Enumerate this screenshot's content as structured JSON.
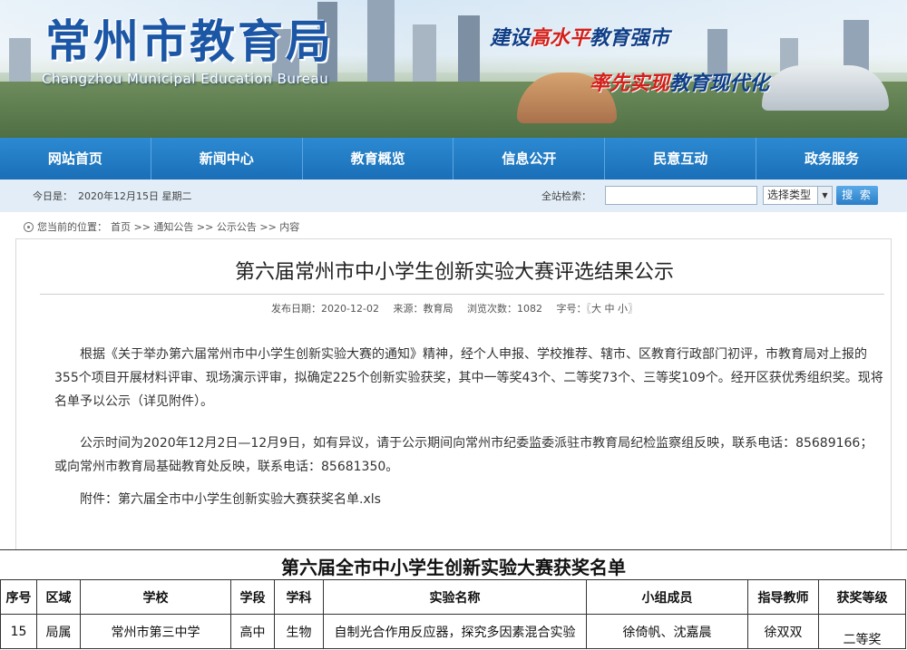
{
  "banner": {
    "title": "常州市教育局",
    "subtitle_en": "Changzhou Municipal Education Bureau",
    "slogan1_pre": "建设",
    "slogan1_hl": "高水平",
    "slogan1_post": "教育强市",
    "slogan2_hl": "率先实现",
    "slogan2_post": "教育现代化"
  },
  "nav": {
    "items": [
      "网站首页",
      "新闻中心",
      "教育概览",
      "信息公开",
      "民意互动",
      "政务服务"
    ]
  },
  "infobar": {
    "today_label": "今日是：",
    "today_value": "2020年12月15日 星期二",
    "search_label": "全站检索：",
    "search_value": "",
    "type_select": "选择类型",
    "search_button": "搜 索"
  },
  "breadcrumb": {
    "prefix": "您当前的位置：",
    "path": "首页 >> 通知公告 >> 公示公告 >> 内容"
  },
  "article": {
    "title": "第六届常州市中小学生创新实验大赛评选结果公示",
    "meta": {
      "date": "发布日期：2020-12-02",
      "source": "来源：教育局",
      "views": "浏览次数：1082",
      "fontsize": "字号：〖大 中 小〗"
    },
    "p1": "根据《关于举办第六届常州市中小学生创新实验大赛的通知》精神，经个人申报、学校推荐、辖市、区教育行政部门初评，市教育局对上报的355个项目开展材料评审、现场演示评审，拟确定225个创新实验获奖，其中一等奖43个、二等奖73个、三等奖109个。经开区获优秀组织奖。现将名单予以公示（详见附件）。",
    "p2": "公示时间为2020年12月2日—12月9日，如有异议，请于公示期间向常州市纪委监委派驻市教育局纪检监察组反映，联系电话：85689166；或向常州市教育局基础教育处反映，联系电话：85681350。",
    "p3": "附件：第六届全市中小学生创新实验大赛获奖名单.xls"
  },
  "sheet": {
    "title": "第六届全市中小学生创新实验大赛获奖名单",
    "headers": [
      "序号",
      "区域",
      "学校",
      "学段",
      "学科",
      "实验名称",
      "小组成员",
      "指导教师",
      "获奖等级"
    ],
    "row": [
      "15",
      "局属",
      "常州市第三中学",
      "高中",
      "生物",
      "自制光合作用反应器，探究多因素混合实验",
      "徐倚帆、沈嘉晨",
      "徐双双",
      "二等奖"
    ]
  },
  "chart_data": {
    "type": "table",
    "title": "第六届全市中小学生创新实验大赛获奖名单",
    "columns": [
      "序号",
      "区域",
      "学校",
      "学段",
      "学科",
      "实验名称",
      "小组成员",
      "指导教师",
      "获奖等级"
    ],
    "rows": [
      [
        "15",
        "局属",
        "常州市第三中学",
        "高中",
        "生物",
        "自制光合作用反应器，探究多因素混合实验",
        "徐倚帆、沈嘉晨",
        "徐双双",
        "二等奖"
      ]
    ]
  },
  "colors": {
    "nav_bg": "#1a6fb7",
    "banner_title": "#1c57a6",
    "slogan_highlight": "#d4201b",
    "infobar_bg": "#e2edf7"
  }
}
